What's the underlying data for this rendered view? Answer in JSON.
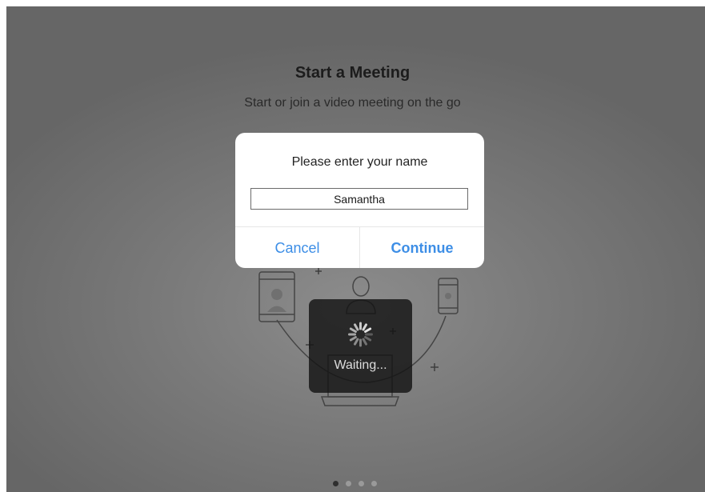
{
  "onboarding": {
    "title": "Start a Meeting",
    "subtitle": "Start or join a video meeting on the go",
    "page_count": 4,
    "active_page_index": 0
  },
  "dialog": {
    "message": "Please enter your name",
    "name_value": "Samantha",
    "cancel_label": "Cancel",
    "continue_label": "Continue"
  },
  "loading": {
    "label": "Waiting..."
  },
  "colors": {
    "accent": "#3d8ee6",
    "overlay": "#7a7a7a",
    "hud": "#141414"
  },
  "icons": [
    "tablet-icon",
    "person-icon",
    "phone-icon",
    "laptop-icon",
    "plus-icon",
    "spinner-icon"
  ]
}
